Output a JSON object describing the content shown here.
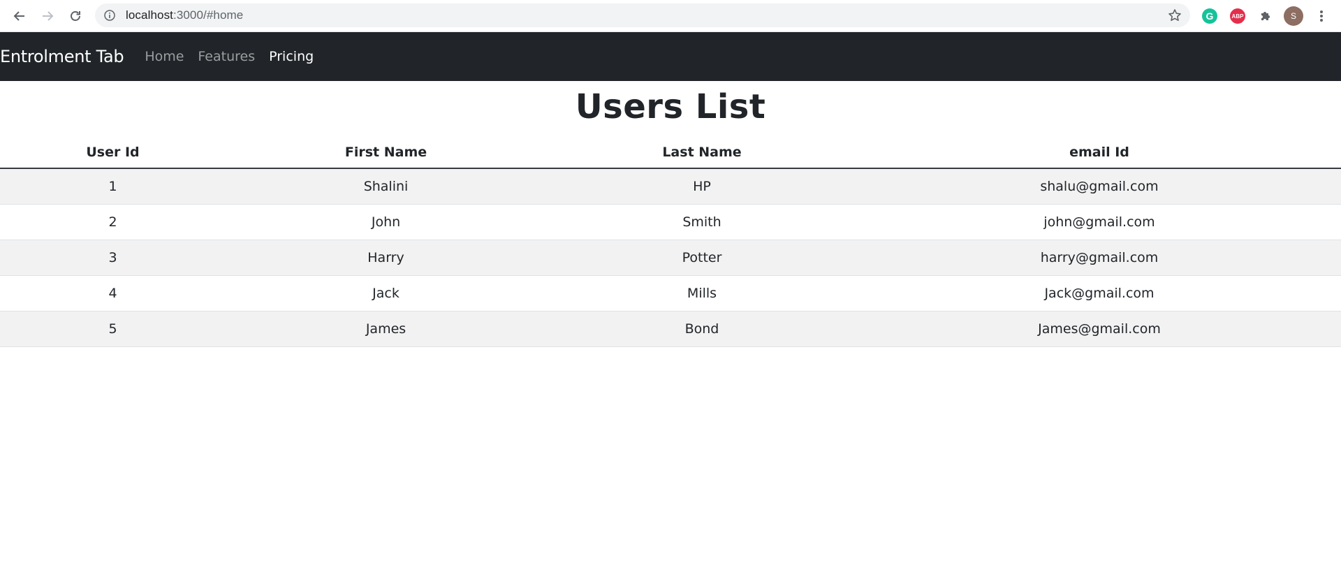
{
  "browser": {
    "url_host": "localhost",
    "url_path": ":3000/#home",
    "avatar_letter": "S",
    "grammarly_letter": "G",
    "abp_label": "ABP"
  },
  "navbar": {
    "brand": "Entrolment Tab",
    "links": [
      {
        "label": "Home"
      },
      {
        "label": "Features"
      },
      {
        "label": "Pricing"
      }
    ]
  },
  "page": {
    "title": "Users List"
  },
  "table": {
    "headers": [
      "User Id",
      "First Name",
      "Last Name",
      "email Id"
    ],
    "rows": [
      [
        "1",
        "Shalini",
        "HP",
        "shalu@gmail.com"
      ],
      [
        "2",
        "John",
        "Smith",
        "john@gmail.com"
      ],
      [
        "3",
        "Harry",
        "Potter",
        "harry@gmail.com"
      ],
      [
        "4",
        "Jack",
        "Mills",
        "Jack@gmail.com"
      ],
      [
        "5",
        "James",
        "Bond",
        "James@gmail.com"
      ]
    ]
  },
  "colors": {
    "navbar_bg": "#212529",
    "stripe": "#f2f2f2",
    "text": "#212529"
  }
}
